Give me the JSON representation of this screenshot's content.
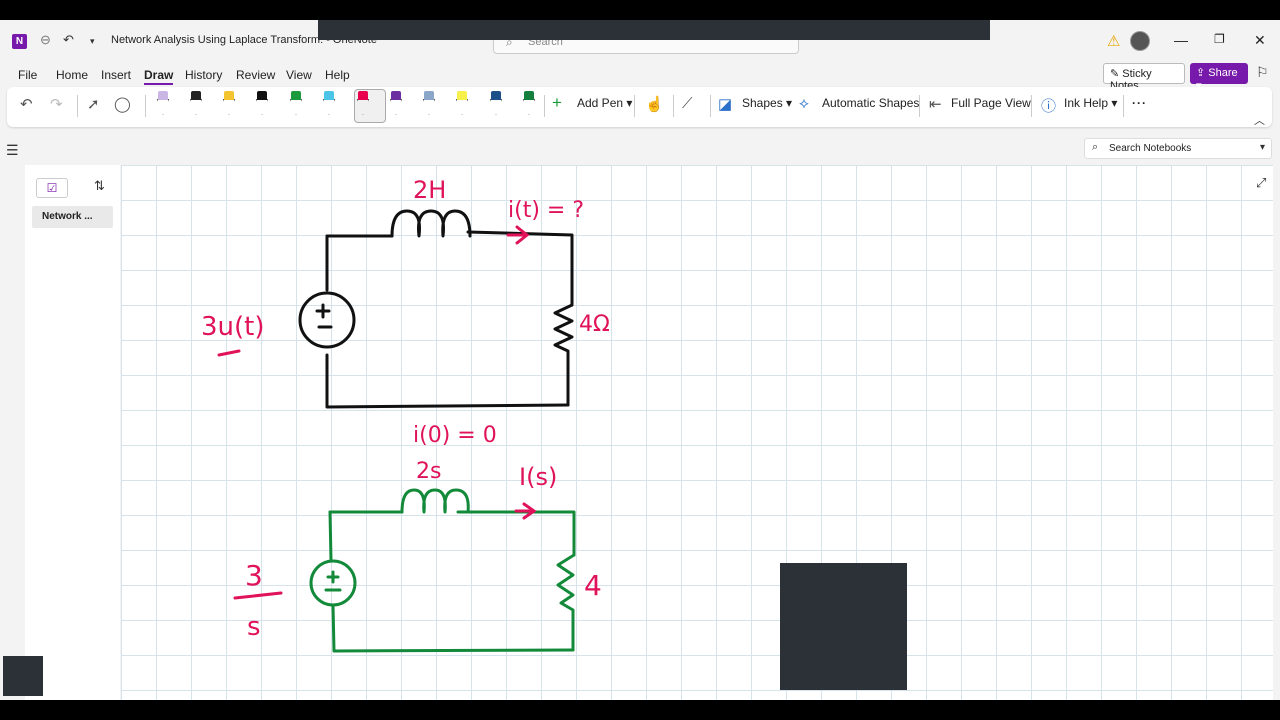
{
  "window": {
    "title": "Network Analysis Using Laplace Transform:  -  OneNote",
    "search_placeholder": "Search",
    "app_icon_letter": "N"
  },
  "menu": {
    "items": [
      "File",
      "Home",
      "Insert",
      "Draw",
      "History",
      "Review",
      "View",
      "Help"
    ],
    "active": "Draw",
    "sticky_notes": "Sticky Notes",
    "share": "Share"
  },
  "ribbon": {
    "add_pen": "Add Pen",
    "shapes": "Shapes",
    "automatic_shapes": "Automatic Shapes",
    "full_page_view": "Full Page View",
    "ink_help": "Ink Help",
    "pens": [
      {
        "name": "pen-lavender",
        "color": "#c9b6e4"
      },
      {
        "name": "pen-black-thin",
        "color": "#222222"
      },
      {
        "name": "pen-yellow",
        "color": "#f4c430"
      },
      {
        "name": "pen-black",
        "color": "#111111"
      },
      {
        "name": "pen-green",
        "color": "#1a9a3c"
      },
      {
        "name": "pen-cyan",
        "color": "#4cc4e8"
      },
      {
        "name": "pen-magenta",
        "color": "#e8004f"
      },
      {
        "name": "pen-purple",
        "color": "#6b2fa0"
      },
      {
        "name": "pen-galaxy",
        "color": "#8aa6c8"
      },
      {
        "name": "pen-highlighter-yellow",
        "color": "#f7f04a"
      },
      {
        "name": "pen-navy",
        "color": "#1c4f8a"
      },
      {
        "name": "pen-dark-green",
        "color": "#15803d"
      }
    ]
  },
  "search_notebooks": "Search Notebooks",
  "sidebar": {
    "page_label": "Network ..."
  },
  "ink": {
    "top_circuit": {
      "inductor": "2H",
      "current": "i(t) = ?",
      "source": "3u(t)",
      "resistor": "4Ω",
      "initial": "i(0) = 0"
    },
    "bottom_circuit": {
      "inductor": "2s",
      "current": "I(s)",
      "source_num": "3",
      "source_den": "s",
      "resistor": "4"
    },
    "colors": {
      "black": "#111111",
      "magenta": "#e0125a",
      "green": "#128a3a"
    }
  }
}
